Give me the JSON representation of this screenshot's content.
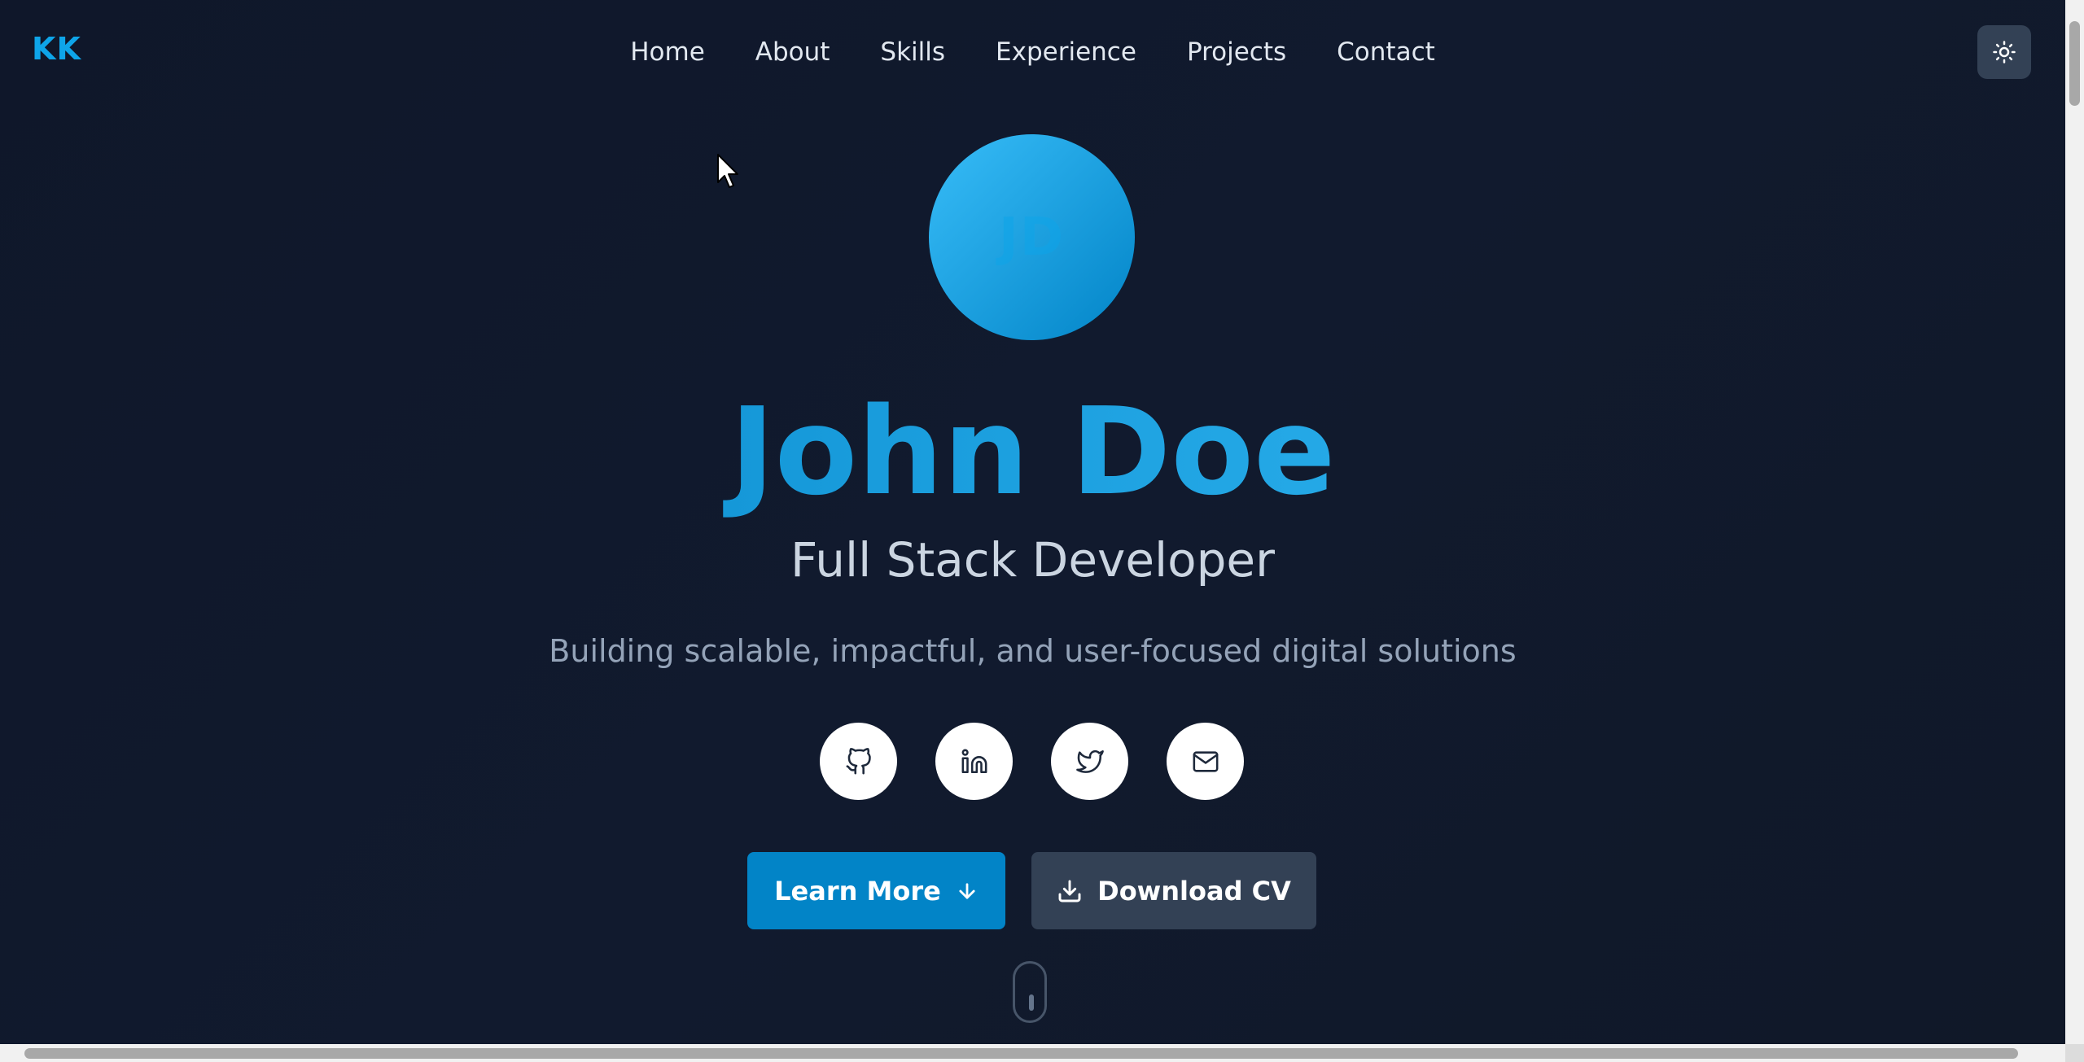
{
  "header": {
    "logo": "KK",
    "nav": [
      "Home",
      "About",
      "Skills",
      "Experience",
      "Projects",
      "Contact"
    ],
    "theme_toggle_icon": "sun-icon"
  },
  "hero": {
    "avatar_initials": "JD",
    "name": "John Doe",
    "role": "Full Stack Developer",
    "tagline": "Building scalable, impactful, and user-focused digital solutions",
    "socials": [
      {
        "icon": "github-icon"
      },
      {
        "icon": "linkedin-icon"
      },
      {
        "icon": "twitter-icon"
      },
      {
        "icon": "mail-icon"
      }
    ],
    "primary_button": "Learn More",
    "secondary_button": "Download CV",
    "scroll_indicator_icon": "mouse-scroll-icon"
  },
  "colors": {
    "accent": "#0ea5e9",
    "accent_dark": "#0284c7",
    "background": "#0f172a",
    "secondary_button": "#334155"
  }
}
